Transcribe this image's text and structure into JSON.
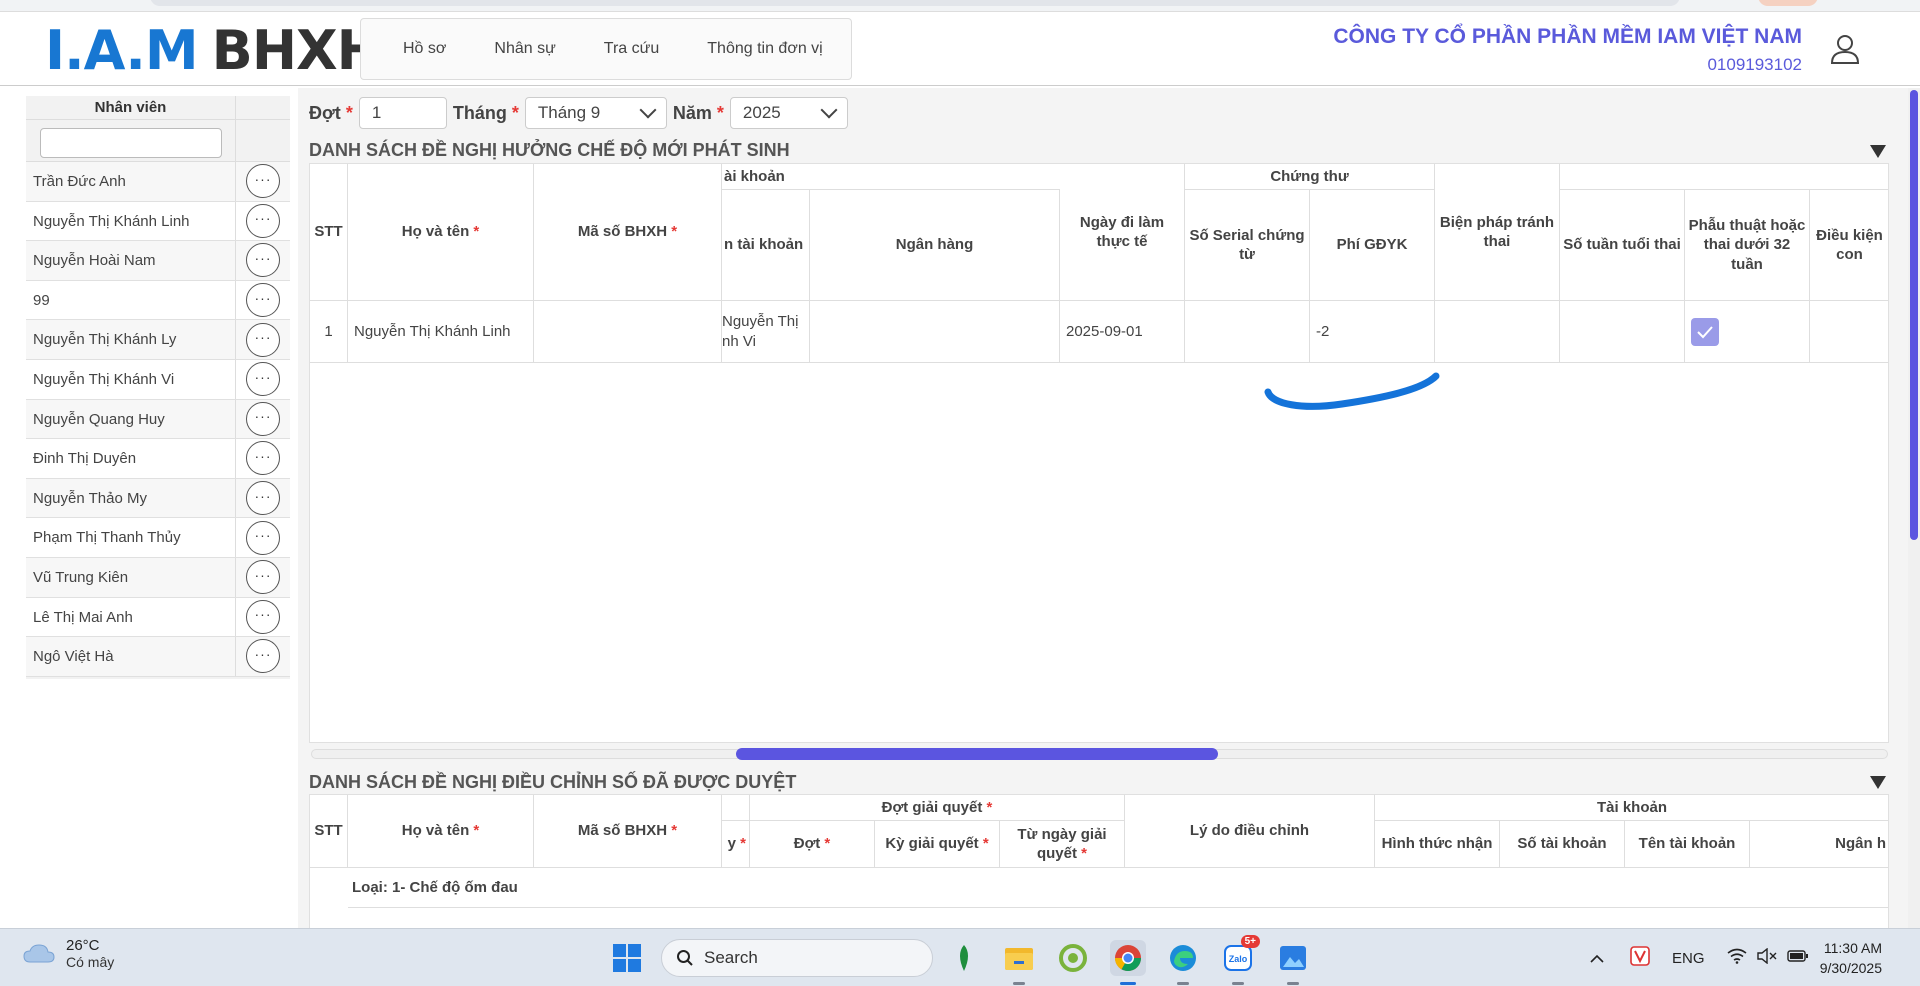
{
  "header": {
    "logo_iam": "I.A.M",
    "logo_bhxh": "BHXH",
    "nav": [
      "Hồ sơ",
      "Nhân sự",
      "Tra cứu",
      "Thông tin đơn vị"
    ],
    "company_name": "CÔNG TY CỔ PHẦN PHẦN MỀM IAM VIỆT NAM",
    "tax_code": "0109193102"
  },
  "sidebar": {
    "title": "Nhân viên",
    "filter_value": "",
    "employees": [
      "Trần Đức Anh",
      "Nguyễn Thị Khánh Linh",
      "Nguyễn Hoài Nam",
      "99",
      "Nguyễn Thị Khánh Ly",
      "Nguyễn Thị Khánh Vi",
      "Nguyễn Quang Huy",
      "Đinh Thị Duyên",
      "Nguyễn Thảo My",
      "Phạm Thị Thanh Thủy",
      "Vũ Trung Kiên",
      "Lê Thị Mai Anh",
      "Ngô Việt Hà"
    ],
    "more_label": "···"
  },
  "filters": {
    "dot_label": "Đợt",
    "dot_value": "1",
    "thang_label": "Tháng",
    "thang_value": "Tháng 9",
    "nam_label": "Năm",
    "nam_value": "2025",
    "required_mark": "*"
  },
  "section1": {
    "title": "DANH SÁCH ĐỀ NGHỊ HƯỞNG CHẾ ĐỘ MỚI PHÁT SINH",
    "headers": {
      "stt": "STT",
      "ho_ten": "Họ và tên",
      "ma_so": "Mã số BHXH",
      "tai_khoan_group": "ài khoản",
      "ten_tai_khoan": "n tài khoản",
      "ngan_hang": "Ngân hàng",
      "ngay_di_lam": "Ngày đi làm thực tế",
      "chung_thu_group": "Chứng thư",
      "so_serial": "Số Serial chứng từ",
      "phi_gdyk": "Phí GĐYK",
      "bien_phap": "Biện pháp tránh thai",
      "so_tuan": "Số tuần tuổi thai",
      "phau_thuat": "Phẫu thuật hoặc thai dưới 32 tuần",
      "dieu_kien": "Điều kiện con"
    },
    "row": {
      "stt": "1",
      "ho_ten": "Nguyễn Thị Khánh Linh",
      "ma_so": "",
      "ten_tai_khoan": "Nguyễn Thị\nnh Vi",
      "ngan_hang": "",
      "ngay_di_lam": "2025-09-01",
      "so_serial": "",
      "phi_gdyk": "-2",
      "bien_phap": "",
      "so_tuan": "",
      "phau_thuat_checked": true
    }
  },
  "section2": {
    "title": "DANH SÁCH ĐỀ NGHỊ ĐIỀU CHỈNH SỐ ĐÃ ĐƯỢC DUYỆT",
    "headers": {
      "stt": "STT",
      "ho_ten": "Họ và tên",
      "ma_so": "Mã số BHXH",
      "partial": "y",
      "dot_group": "Đợt giải quyết",
      "dot": "Đợt",
      "ky": "Kỳ giải quyết",
      "tu_ngay": "Từ ngày giải quyết",
      "ly_do": "Lý do điều chỉnh",
      "tai_khoan_group": "Tài khoản",
      "hinh_thuc": "Hình thức nhận",
      "so_tk": "Số tài khoản",
      "ten_tk": "Tên tài khoản",
      "ngan_hang": "Ngân h"
    },
    "group_row": "Loại: 1- Chế độ ốm đau"
  },
  "taskbar": {
    "temp": "26°C",
    "weather": "Có mây",
    "search_placeholder": "Search",
    "zalo_badge": "5+",
    "lang": "ENG",
    "time": "11:30 AM",
    "date": "9/30/2025"
  },
  "colors": {
    "brand_blue": "#1877d2",
    "brand_red": "#e53935",
    "accent_purple": "#5a5adb",
    "scroll_thumb": "#5b55e0",
    "checkbox": "#9a9be8"
  }
}
